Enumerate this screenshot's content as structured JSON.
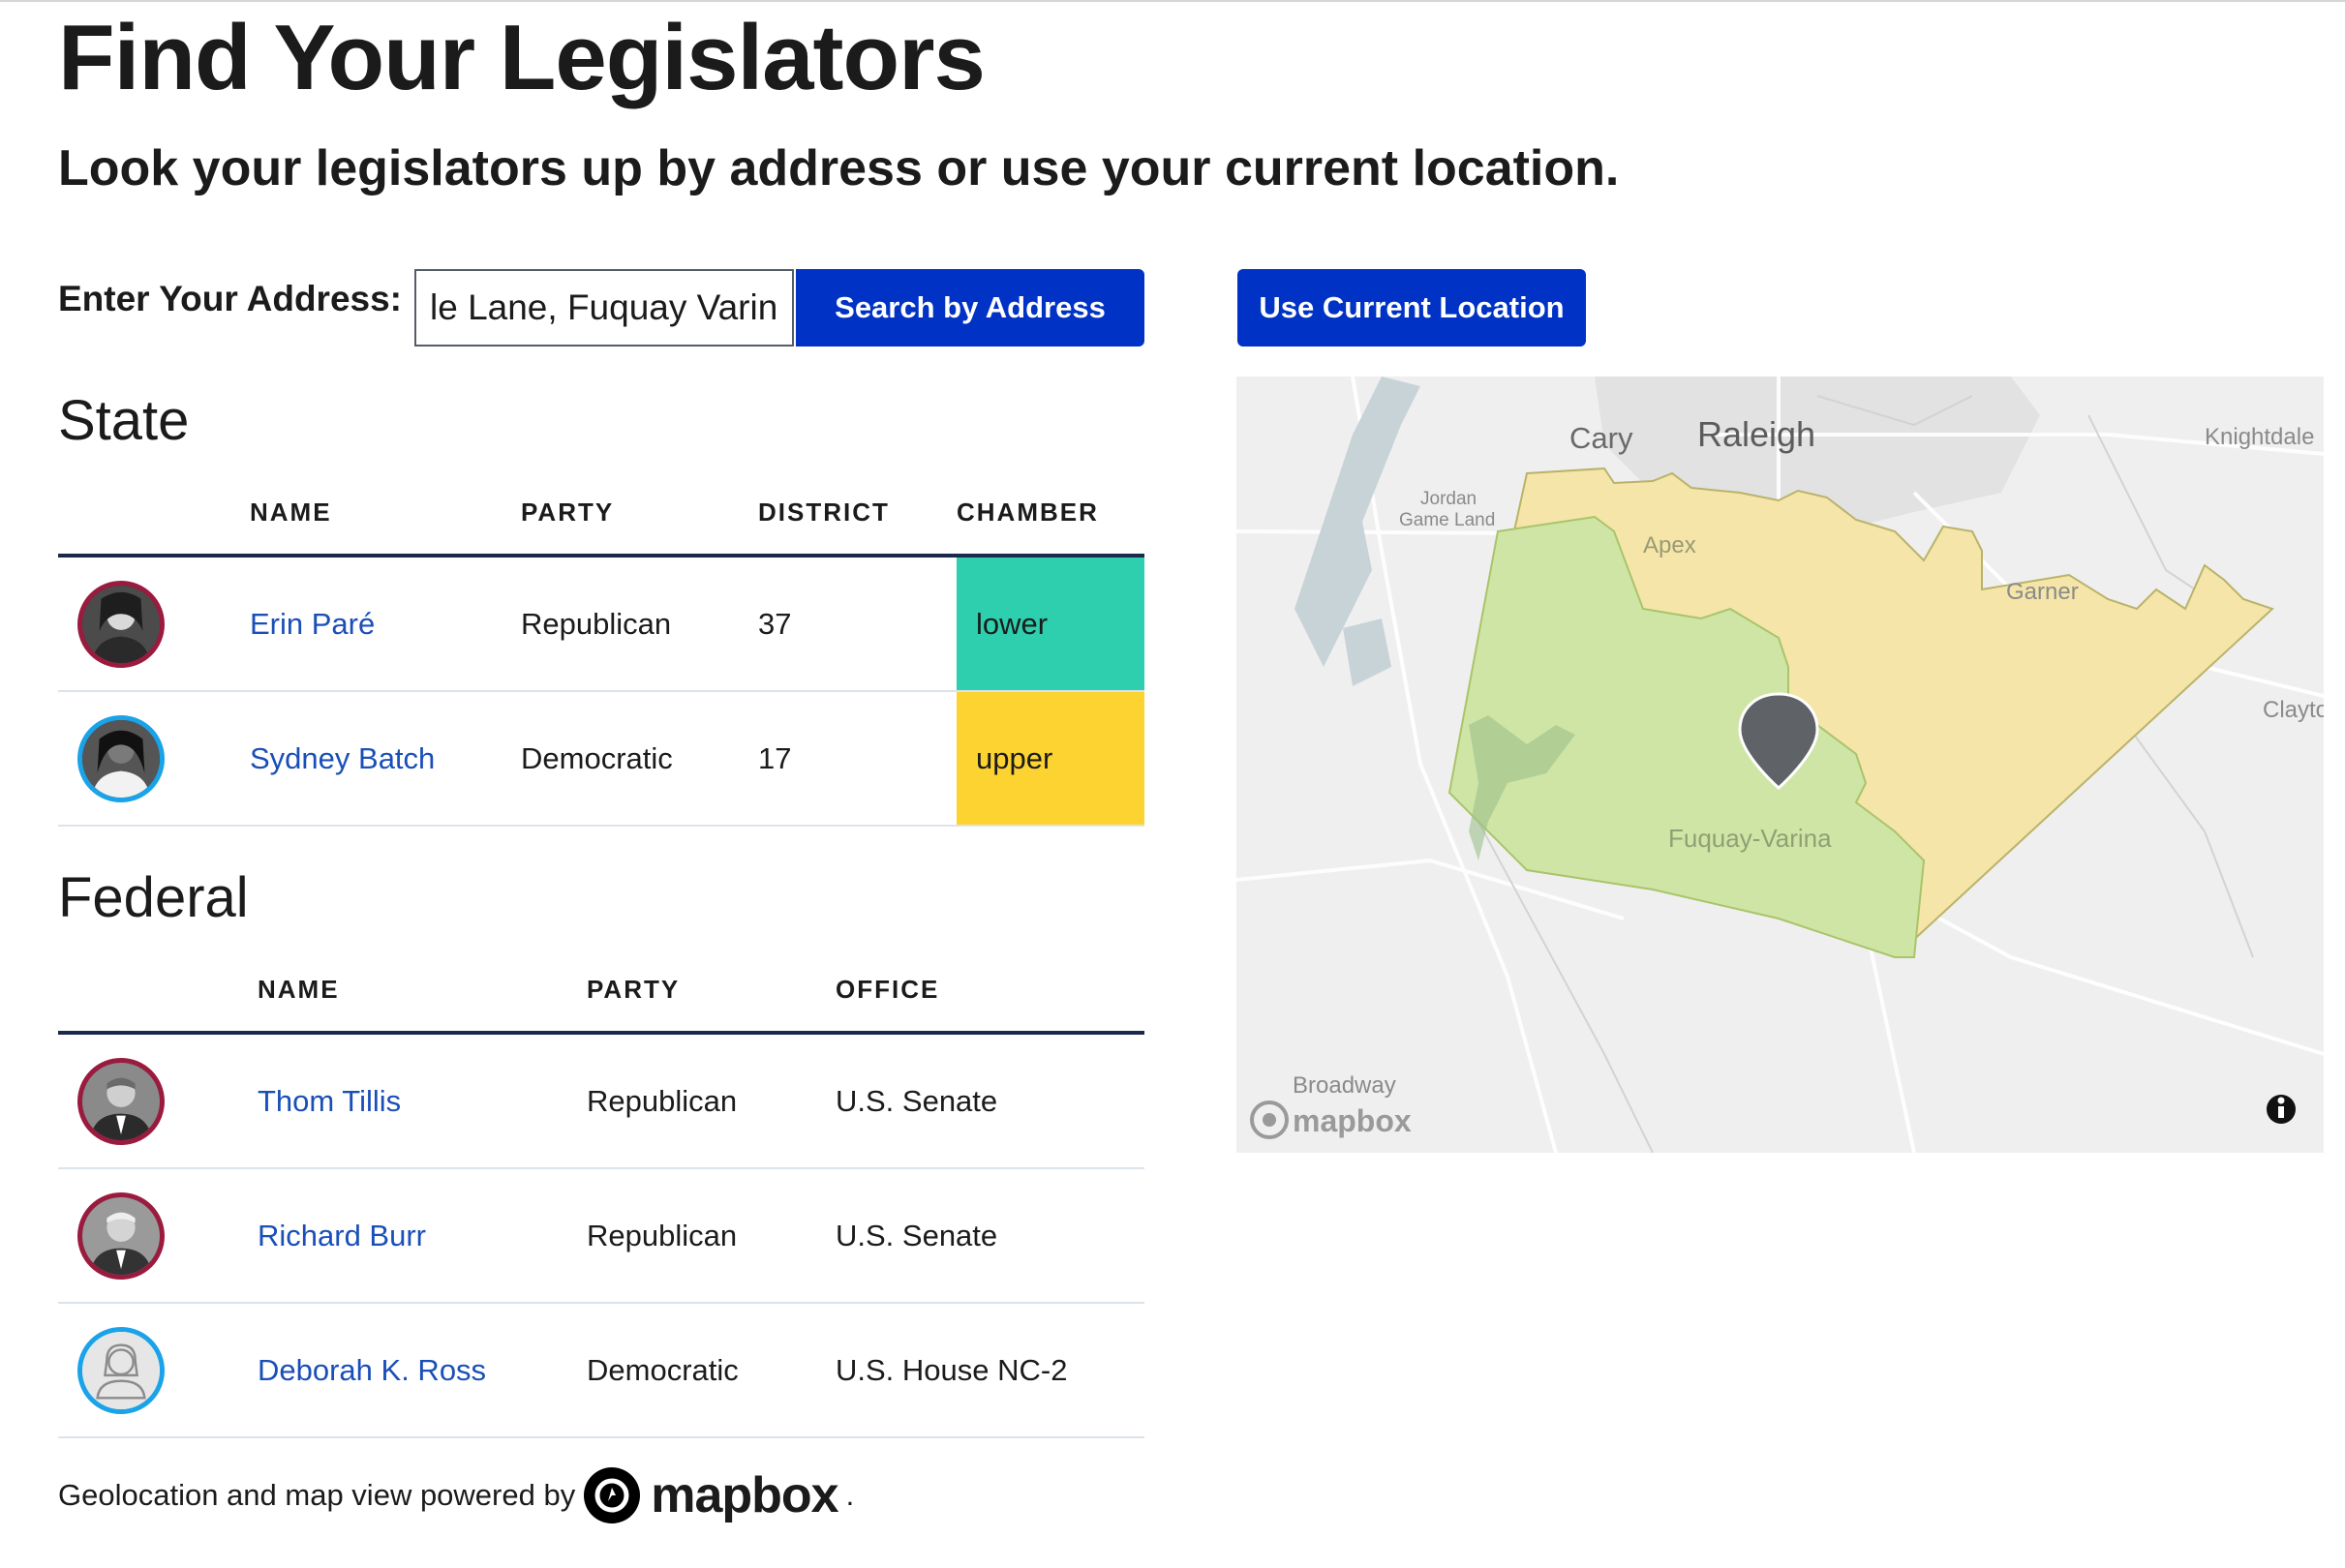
{
  "page": {
    "title": "Find Your Legislators",
    "subtitle": "Look your legislators up by address or use your current location."
  },
  "search": {
    "label": "Enter Your Address:",
    "value": "le Lane, Fuquay Varina",
    "search_button": "Search by Address",
    "location_button": "Use Current Location"
  },
  "state": {
    "title": "State",
    "headers": [
      "NAME",
      "PARTY",
      "DISTRICT",
      "CHAMBER"
    ],
    "rows": [
      {
        "name": "Erin Paré",
        "party": "Republican",
        "district": "37",
        "chamber": "lower",
        "ring": "#9b1b3f"
      },
      {
        "name": "Sydney Batch",
        "party": "Democratic",
        "district": "17",
        "chamber": "upper",
        "ring": "#1aa3e8"
      }
    ]
  },
  "federal": {
    "title": "Federal",
    "headers": [
      "NAME",
      "PARTY",
      "OFFICE"
    ],
    "rows": [
      {
        "name": "Thom Tillis",
        "party": "Republican",
        "office": "U.S. Senate",
        "ring": "#9b1b3f"
      },
      {
        "name": "Richard Burr",
        "party": "Republican",
        "office": "U.S. Senate",
        "ring": "#9b1b3f"
      },
      {
        "name": "Deborah K. Ross",
        "party": "Democratic",
        "office": "U.S. House NC-2",
        "ring": "#1aa3e8"
      }
    ]
  },
  "map": {
    "labels": {
      "cary": "Cary",
      "raleigh": "Raleigh",
      "knightdale": "Knightdale",
      "jordan": "Jordan",
      "game_land": "Game Land",
      "apex": "Apex",
      "garner": "Garner",
      "clayton": "Clayto",
      "fuquay": "Fuquay-Varina",
      "broadway": "Broadway",
      "attribution": "mapbox"
    },
    "colors": {
      "district_upper": "#f5e5a8",
      "district_lower": "#cfe5a6",
      "water": "#c8d3d8",
      "marker": "#5f6368"
    },
    "marker_icon": "map-pin-icon",
    "info_icon": "info-icon"
  },
  "footer": {
    "text": "Geolocation and map view powered by",
    "brand": "mapbox",
    "period": "."
  },
  "colors": {
    "primary_button": "#0033c5",
    "link": "#1a4fb8",
    "lower": "#2dcfae",
    "upper": "#fdd332"
  }
}
